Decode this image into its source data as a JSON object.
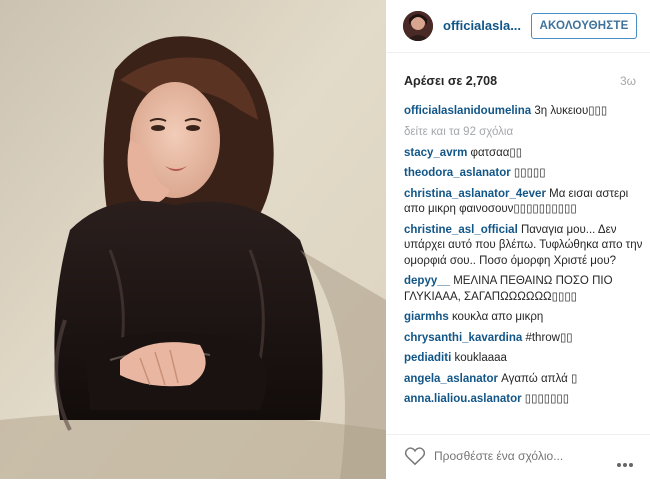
{
  "post": {
    "photo_alt": "Photo of woman in leather jacket"
  },
  "header": {
    "username": "officialasla...",
    "follow_label": "ΑΚΟΛΟΥΘΗΣΤΕ"
  },
  "stats": {
    "likes": "Αρέσει σε 2,708",
    "age": "3ω"
  },
  "caption": {
    "user": "officialaslanidoumelina",
    "text": " 3η λυκειου▯▯▯"
  },
  "view_all": "δείτε και τα 92 σχόλια",
  "comments": [
    {
      "user": "stacy_avrm",
      "text": " φατσαα▯▯"
    },
    {
      "user": "theodora_aslanator",
      "text": " ▯▯▯▯▯"
    },
    {
      "user": "christina_aslanator_4ever",
      "text": " Μα εισαι αστερι απο μικρη φαινοσουν▯▯▯▯▯▯▯▯▯▯"
    },
    {
      "user": "christine_asl_official",
      "text": " Παναγια μου... Δεν υπάρχει αυτό που βλέπω. Τυφλώθηκα απο την ομορφιά σου.. Ποσο όμορφη Χριστέ μου?"
    },
    {
      "user": "depyy__",
      "text": " ΜΕΛΙΝΑ ΠΕΘΑΙΝΩ ΠΟΣΟ ΠΙΟ ΓΛΥΚΙΑΑΑ, ΣΑΓΑΠΩΩΩΩΩΩ▯▯▯▯"
    },
    {
      "user": "giarmhs",
      "text": " κουκλα απο μικρη"
    },
    {
      "user": "chrysanthi_kavardina",
      "text": " #throw▯▯"
    },
    {
      "user": "pediaditi",
      "text": " kouklaaaa"
    },
    {
      "user": "angela_aslanator",
      "text": " Αγαπώ απλά ▯"
    },
    {
      "user": "anna.lialiou.aslanator",
      "text": " ▯▯▯▯▯▯▯"
    }
  ],
  "footer": {
    "add_comment_placeholder": "Προσθέστε ένα σχόλιο..."
  },
  "icons": {
    "like": "heart-icon",
    "options": "more-options-icon"
  },
  "colors": {
    "username": "#125688",
    "follow_border": "#4a90c8",
    "muted": "#a5a7aa"
  }
}
